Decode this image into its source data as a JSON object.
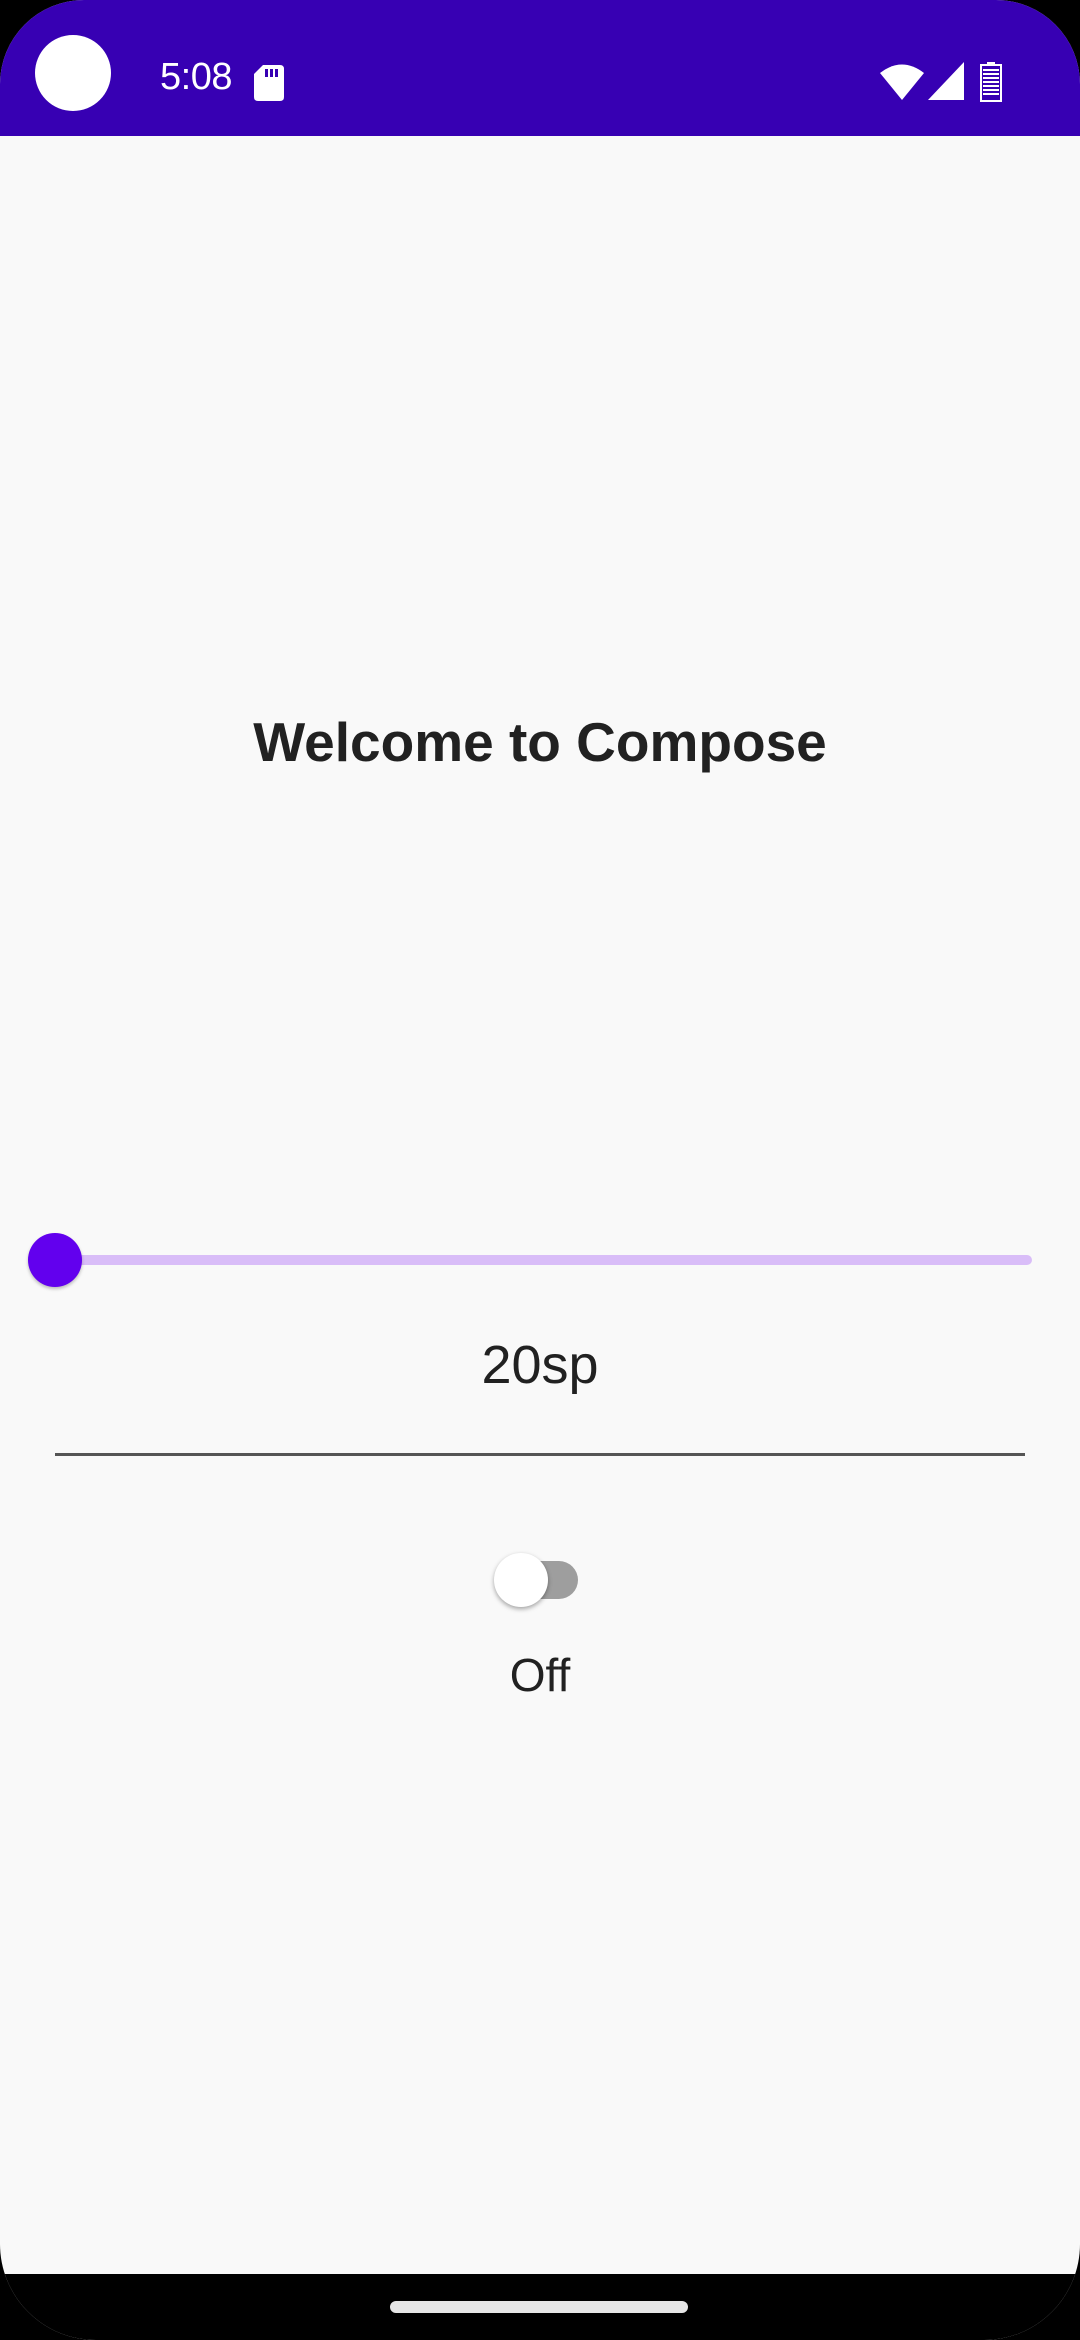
{
  "status_bar": {
    "time": "5:08",
    "icons": [
      "camera-cutout",
      "sd-card-icon",
      "wifi-icon",
      "cell-signal-icon",
      "battery-icon"
    ],
    "background_color": "#3700b3"
  },
  "main": {
    "title": "Welcome to Compose",
    "slider": {
      "value_fraction": 0.0,
      "active_color": "#6200ee",
      "inactive_color": "#d9bdf8"
    },
    "font_size_text": "20sp",
    "switch": {
      "checked": false,
      "state_label": "Off"
    }
  },
  "nav_bar": {
    "icons": [
      "home-indicator"
    ]
  },
  "colors": {
    "background": "#f9f9f9",
    "primary": "#6200ee",
    "primary_dark": "#3700b3",
    "text": "#212121"
  }
}
